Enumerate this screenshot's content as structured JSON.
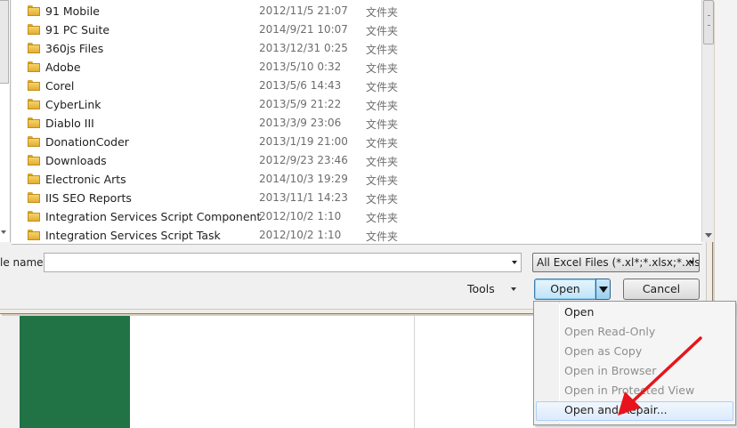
{
  "file_list": {
    "rows": [
      {
        "name": "91 Mobile",
        "date": "2012/11/5 21:07",
        "type": "文件夹"
      },
      {
        "name": "91 PC Suite",
        "date": "2014/9/21 10:07",
        "type": "文件夹"
      },
      {
        "name": "360js Files",
        "date": "2013/12/31 0:25",
        "type": "文件夹"
      },
      {
        "name": "Adobe",
        "date": "2013/5/10 0:32",
        "type": "文件夹"
      },
      {
        "name": "Corel",
        "date": "2013/5/6 14:43",
        "type": "文件夹"
      },
      {
        "name": "CyberLink",
        "date": "2013/5/9 21:22",
        "type": "文件夹"
      },
      {
        "name": "Diablo III",
        "date": "2013/3/9 23:06",
        "type": "文件夹"
      },
      {
        "name": "DonationCoder",
        "date": "2013/1/19 21:00",
        "type": "文件夹"
      },
      {
        "name": "Downloads",
        "date": "2012/9/23 23:46",
        "type": "文件夹"
      },
      {
        "name": "Electronic Arts",
        "date": "2014/10/3 19:29",
        "type": "文件夹"
      },
      {
        "name": "IIS SEO Reports",
        "date": "2013/11/1 14:23",
        "type": "文件夹"
      },
      {
        "name": "Integration Services Script Component",
        "date": "2012/10/2 1:10",
        "type": "文件夹"
      },
      {
        "name": "Integration Services Script Task",
        "date": "2012/10/2 1:10",
        "type": "文件夹"
      }
    ]
  },
  "footer": {
    "filename_label": "le name:",
    "filename_value": "",
    "filter_label": "All Excel Files (*.xl*;*.xlsx;*.xlsm;",
    "tools_label": "Tools",
    "open_label": "Open",
    "cancel_label": "Cancel"
  },
  "open_menu": {
    "items": [
      {
        "label": "Open",
        "enabled": true
      },
      {
        "label": "Open Read-Only",
        "enabled": false
      },
      {
        "label": "Open as Copy",
        "enabled": false
      },
      {
        "label": "Open in Browser",
        "enabled": false
      },
      {
        "label": "Open in Protected View",
        "enabled": false
      },
      {
        "label": "Open and Repair...",
        "enabled": true,
        "highlighted": true
      }
    ]
  },
  "colors": {
    "excel_green": "#217346",
    "annotation_arrow": "#e8141b",
    "folder_yellow": "#e9b73d"
  },
  "icons": {
    "folder": "folder-icon",
    "dropdown": "chevron-down-icon",
    "annotation": "red-arrow-annotation"
  }
}
